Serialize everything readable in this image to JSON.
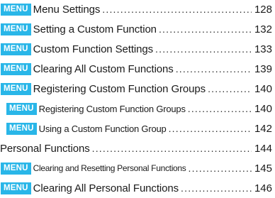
{
  "badge_label": "MENU",
  "entries": [
    {
      "title": "Menu Settings",
      "page": "128"
    },
    {
      "title": "Setting a Custom Function",
      "page": "132"
    },
    {
      "title": "Custom Function Settings",
      "page": "133"
    },
    {
      "title": "Clearing All Custom Functions",
      "page": "139"
    },
    {
      "title": "Registering Custom Function Groups",
      "page": "140"
    },
    {
      "title": "Registering Custom Function Groups",
      "page": "140"
    },
    {
      "title": "Using a Custom Function Group",
      "page": "142"
    },
    {
      "title": "Personal Functions",
      "page": "144"
    },
    {
      "title": "Clearing and Resetting Personal Functions",
      "page": "145"
    },
    {
      "title": "Clearing All Personal Functions",
      "page": "146"
    }
  ],
  "colors": {
    "badge_background": "#29b6e8",
    "badge_text": "#ffffff",
    "text": "#1a1a1a"
  }
}
